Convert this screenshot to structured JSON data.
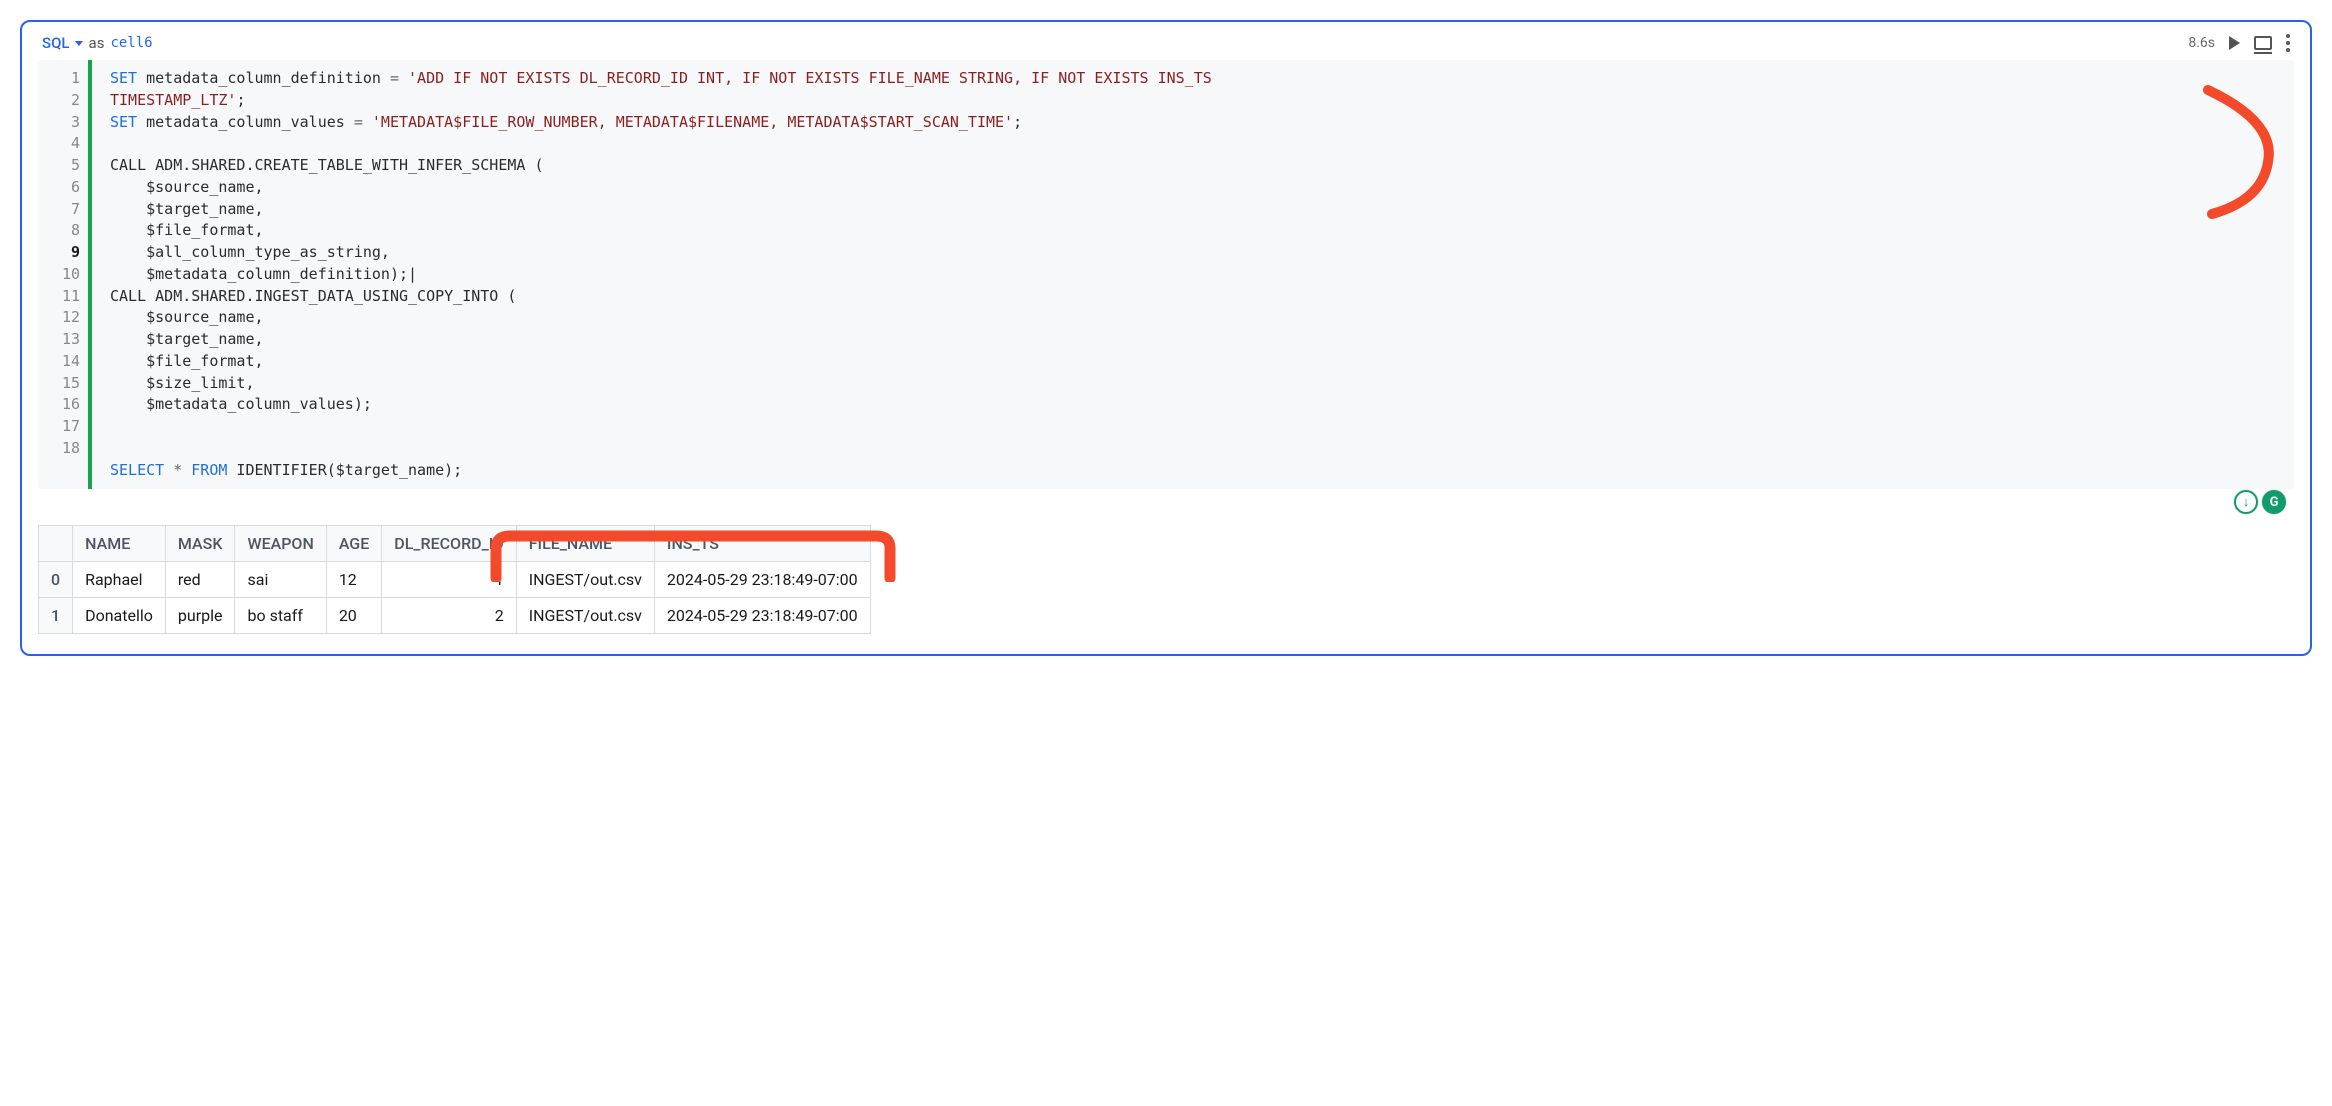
{
  "header": {
    "lang": "SQL",
    "as": "as",
    "cell_name": "cell6",
    "exec_time": "8.6s"
  },
  "code": {
    "line_numbers": [
      "1",
      "2",
      "3",
      "4",
      "5",
      "6",
      "7",
      "8",
      "9",
      "10",
      "11",
      "12",
      "13",
      "14",
      "15",
      "16",
      "17",
      "18"
    ],
    "current_line": 9,
    "lines": [
      {
        "seg": [
          {
            "t": "SET",
            "c": "tok-kw"
          },
          {
            "t": " metadata_column_definition ",
            "c": ""
          },
          {
            "t": "=",
            "c": "tok-op"
          },
          {
            "t": " ",
            "c": ""
          },
          {
            "t": "'ADD IF NOT EXISTS DL_RECORD_ID INT, IF NOT EXISTS FILE_NAME STRING, IF NOT EXISTS INS_TS",
            "c": "tok-str"
          }
        ]
      },
      {
        "cont": true,
        "seg": [
          {
            "t": "TIMESTAMP_LTZ'",
            "c": "tok-str"
          },
          {
            "t": ";",
            "c": ""
          }
        ]
      },
      {
        "seg": [
          {
            "t": "SET",
            "c": "tok-kw"
          },
          {
            "t": " metadata_column_values ",
            "c": ""
          },
          {
            "t": "=",
            "c": "tok-op"
          },
          {
            "t": " ",
            "c": ""
          },
          {
            "t": "'METADATA$FILE_ROW_NUMBER, METADATA$FILENAME, METADATA$START_SCAN_TIME'",
            "c": "tok-str"
          },
          {
            "t": ";",
            "c": ""
          }
        ]
      },
      {
        "seg": [
          {
            "t": "",
            "c": ""
          }
        ]
      },
      {
        "seg": [
          {
            "t": "CALL ADM.SHARED.CREATE_TABLE_WITH_INFER_SCHEMA (",
            "c": ""
          }
        ]
      },
      {
        "seg": [
          {
            "t": "    $source_name,",
            "c": ""
          }
        ]
      },
      {
        "seg": [
          {
            "t": "    $target_name,",
            "c": ""
          }
        ]
      },
      {
        "seg": [
          {
            "t": "    $file_format,",
            "c": ""
          }
        ]
      },
      {
        "seg": [
          {
            "t": "    $all_column_type_as_string,",
            "c": ""
          }
        ]
      },
      {
        "seg": [
          {
            "t": "    $metadata_column_definition);|",
            "c": ""
          }
        ]
      },
      {
        "seg": [
          {
            "t": "CALL ADM.SHARED.INGEST_DATA_USING_COPY_INTO (",
            "c": ""
          }
        ]
      },
      {
        "seg": [
          {
            "t": "    $source_name,",
            "c": ""
          }
        ]
      },
      {
        "seg": [
          {
            "t": "    $target_name,",
            "c": ""
          }
        ]
      },
      {
        "seg": [
          {
            "t": "    $file_format,",
            "c": ""
          }
        ]
      },
      {
        "seg": [
          {
            "t": "    $size_limit,",
            "c": ""
          }
        ]
      },
      {
        "seg": [
          {
            "t": "    $metadata_column_values);",
            "c": ""
          }
        ]
      },
      {
        "seg": [
          {
            "t": "",
            "c": ""
          }
        ]
      },
      {
        "seg": [
          {
            "t": "",
            "c": ""
          }
        ]
      },
      {
        "seg": [
          {
            "t": "SELECT",
            "c": "tok-kw"
          },
          {
            "t": " ",
            "c": ""
          },
          {
            "t": "*",
            "c": "tok-op"
          },
          {
            "t": " ",
            "c": ""
          },
          {
            "t": "FROM",
            "c": "tok-kw"
          },
          {
            "t": " IDENTIFIER($target_name);",
            "c": ""
          }
        ]
      }
    ]
  },
  "results": {
    "columns": [
      "",
      "NAME",
      "MASK",
      "WEAPON",
      "AGE",
      "DL_RECORD_ID",
      "FILE_NAME",
      "INS_TS"
    ],
    "rows": [
      {
        "idx": "0",
        "NAME": "Raphael",
        "MASK": "red",
        "WEAPON": "sai",
        "AGE": "12",
        "DL_RECORD_ID": "1",
        "FILE_NAME": "INGEST/out.csv",
        "INS_TS": "2024-05-29 23:18:49-07:00"
      },
      {
        "idx": "1",
        "NAME": "Donatello",
        "MASK": "purple",
        "WEAPON": "bo staff",
        "AGE": "20",
        "DL_RECORD_ID": "2",
        "FILE_NAME": "INGEST/out.csv",
        "INS_TS": "2024-05-29 23:18:49-07:00"
      }
    ]
  },
  "badges": {
    "db": "↓",
    "gr": "G"
  }
}
